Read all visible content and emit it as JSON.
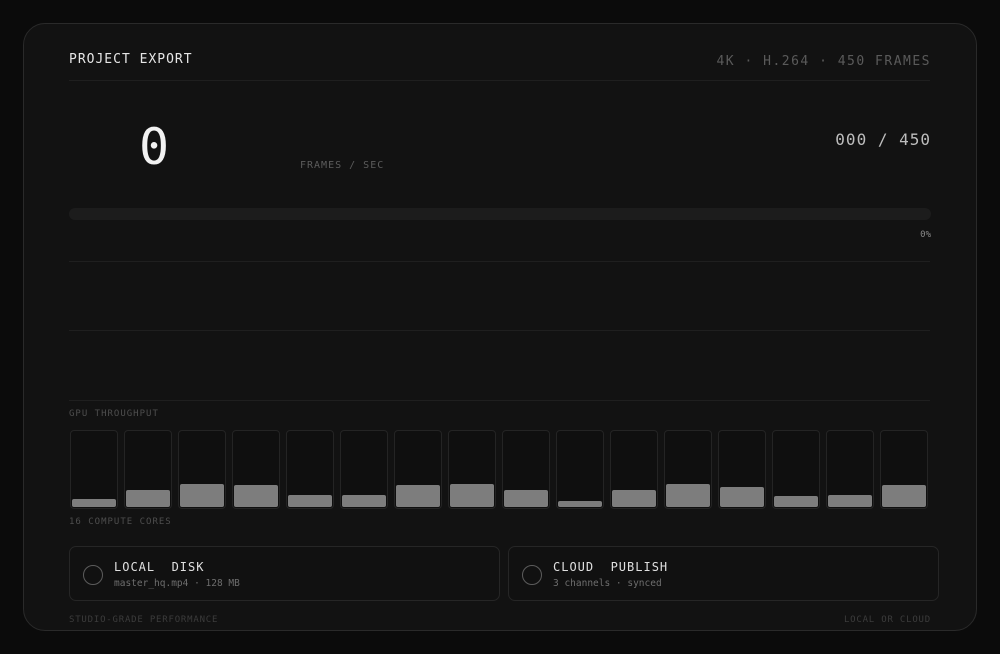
{
  "header": {
    "title": "PROJECT EXPORT",
    "spec": "4K · H.264 · 450 FRAMES"
  },
  "stats": {
    "fps_value": "0",
    "fps_label": "FRAMES / SEC",
    "frame_count": "000 / 450"
  },
  "progress": {
    "percent_label": "0%",
    "value": 0
  },
  "gpu": {
    "label": "GPU THROUGHPUT",
    "cores_label": "16 COMPUTE CORES",
    "core_loads": [
      0.1,
      0.22,
      0.3,
      0.28,
      0.16,
      0.16,
      0.28,
      0.3,
      0.22,
      0.08,
      0.22,
      0.3,
      0.26,
      0.14,
      0.16,
      0.28
    ]
  },
  "destinations": [
    {
      "title": "LOCAL  DISK",
      "subtitle": "master_hq.mp4 · 128 MB",
      "selected": false
    },
    {
      "title": "CLOUD  PUBLISH",
      "subtitle": "3 channels · synced",
      "selected": false
    }
  ],
  "footer": {
    "left": "STUDIO-GRADE PERFORMANCE",
    "right": "LOCAL OR CLOUD"
  }
}
